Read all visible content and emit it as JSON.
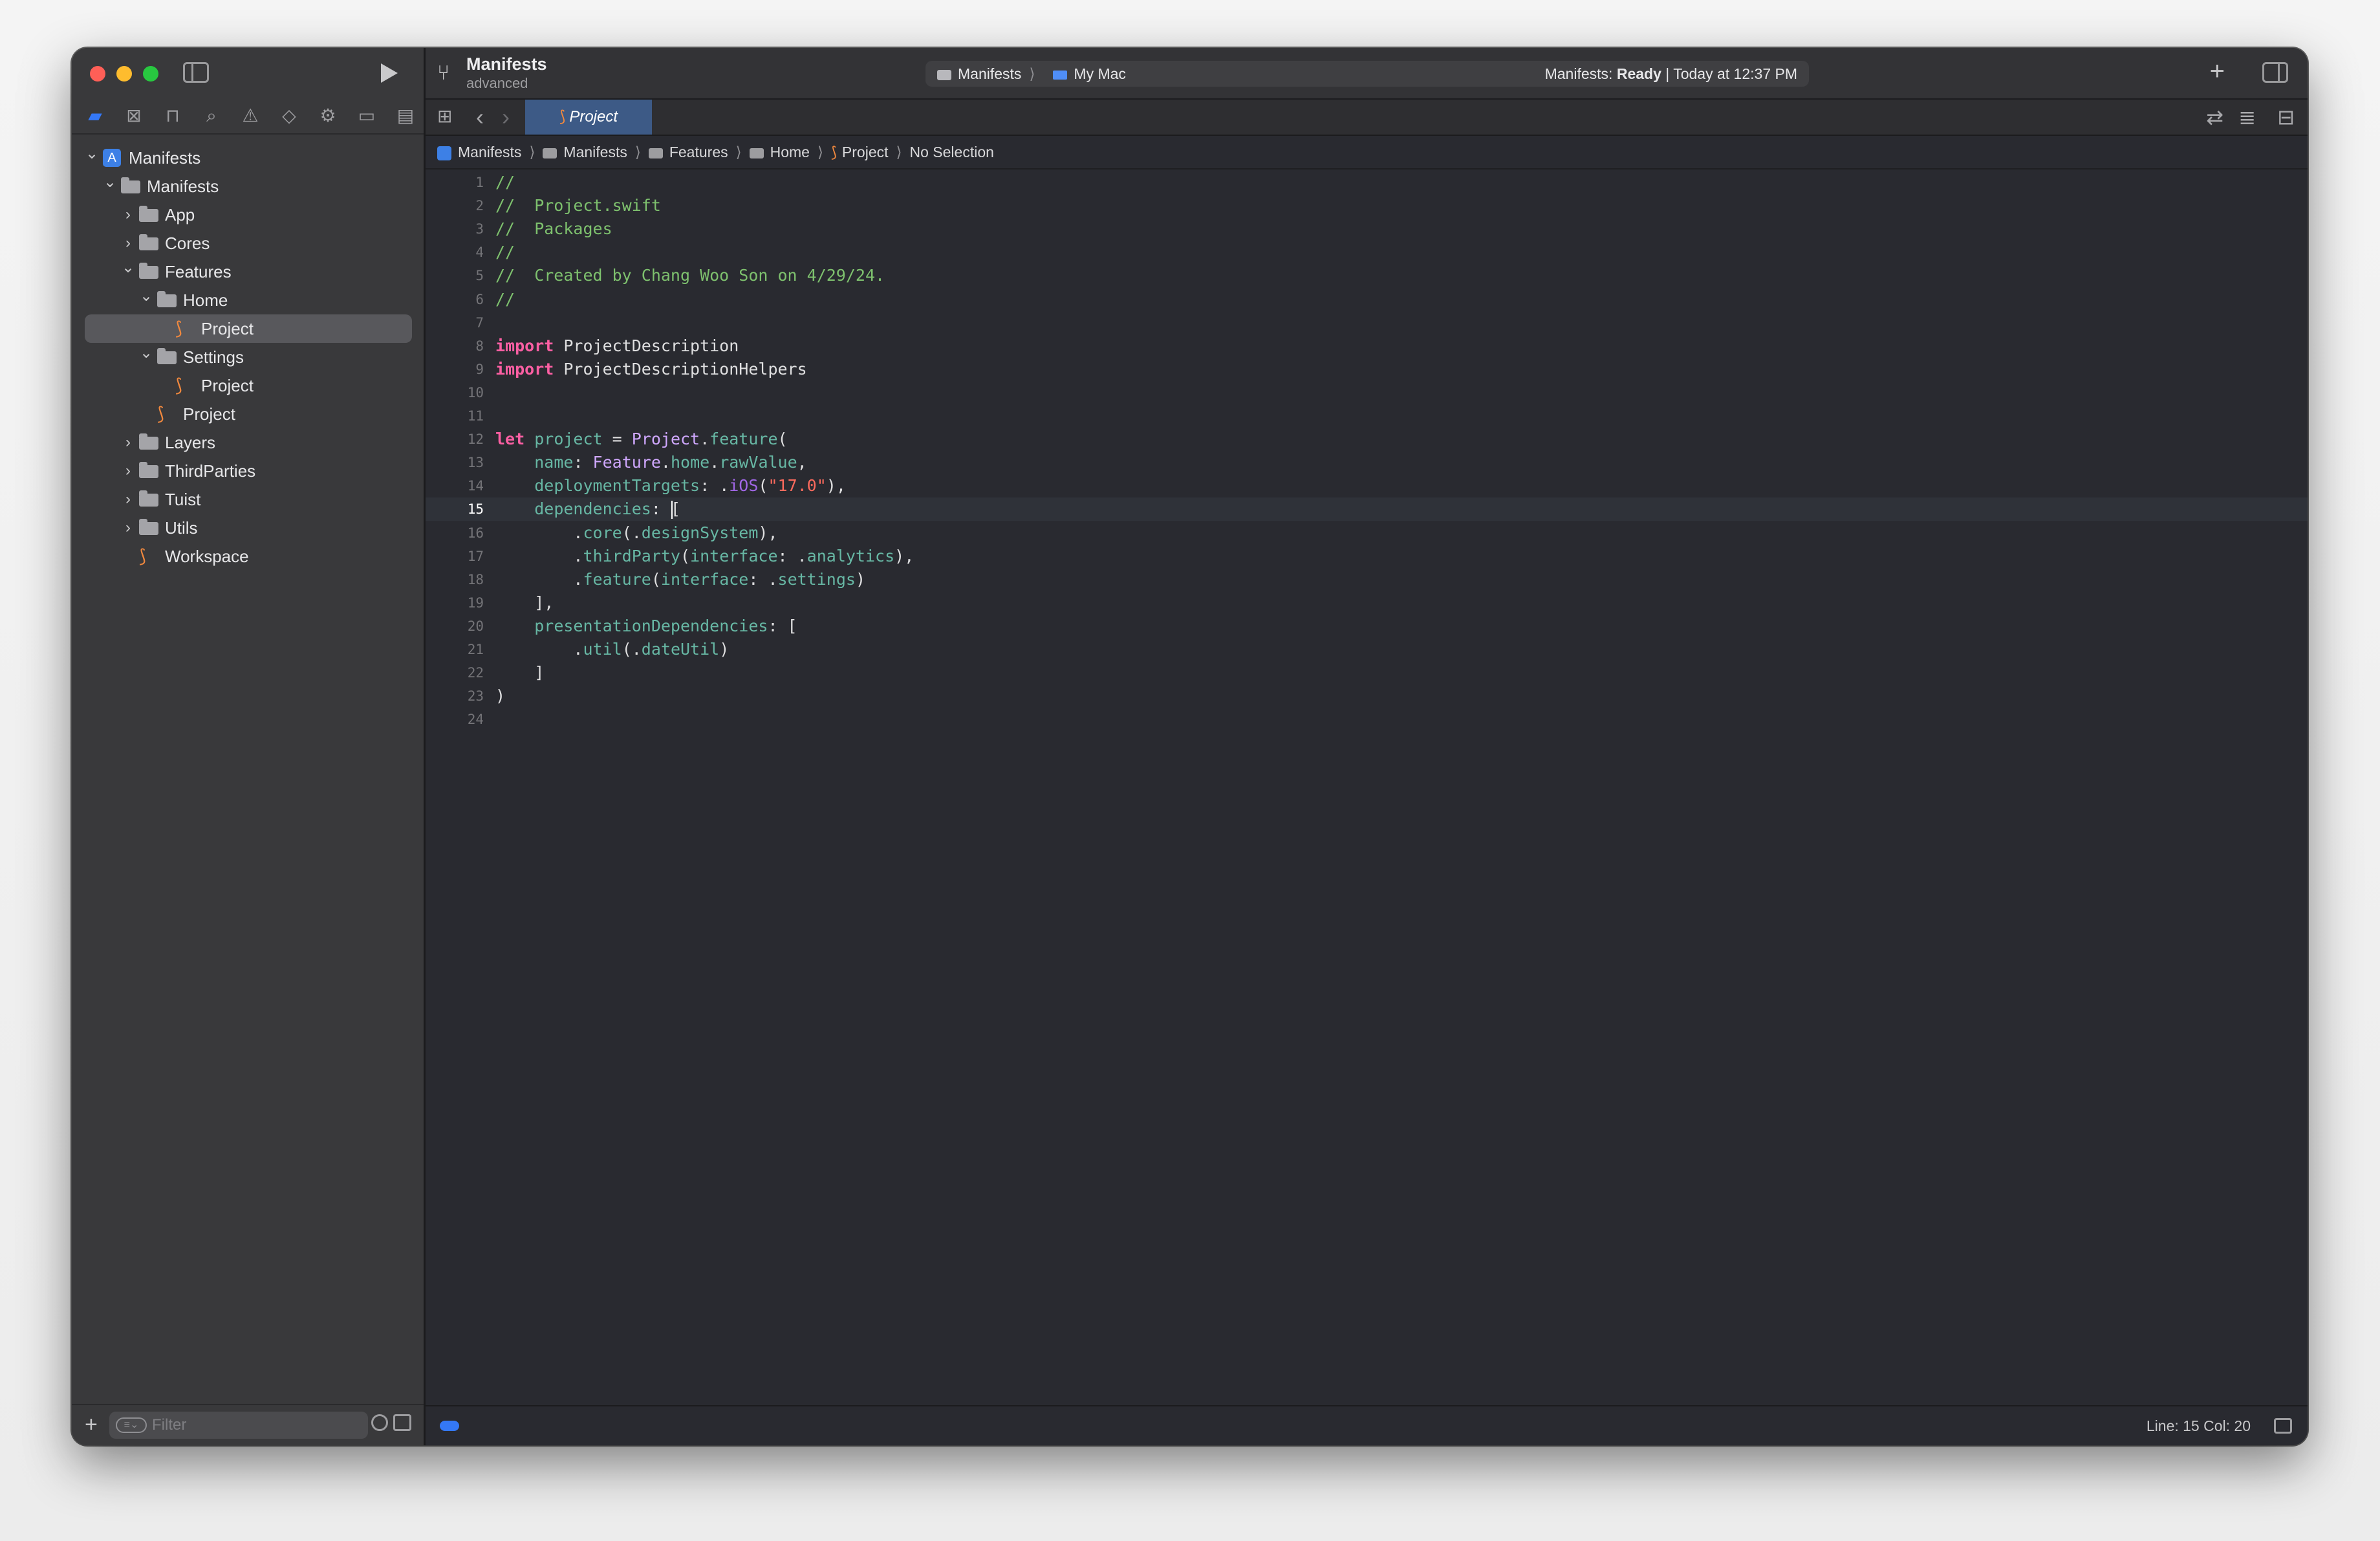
{
  "window": {
    "scheme": {
      "name": "Manifests",
      "branch": "advanced"
    },
    "activity": {
      "target": "Manifests",
      "destination": "My Mac",
      "status_prefix": "Manifests: ",
      "status_state": "Ready",
      "status_suffix": " | Today at 12:37 PM"
    }
  },
  "sidebar": {
    "tree": [
      {
        "label": "Manifests",
        "icon": "project-icon",
        "indent": 0,
        "expanded": true
      },
      {
        "label": "Manifests",
        "icon": "folder-icon",
        "indent": 1,
        "expanded": true
      },
      {
        "label": "App",
        "icon": "folder-icon",
        "indent": 2,
        "expanded": false
      },
      {
        "label": "Cores",
        "icon": "folder-icon",
        "indent": 2,
        "expanded": false
      },
      {
        "label": "Features",
        "icon": "folder-icon",
        "indent": 2,
        "expanded": true
      },
      {
        "label": "Home",
        "icon": "folder-icon",
        "indent": 3,
        "expanded": true
      },
      {
        "label": "Project",
        "icon": "swift-icon",
        "indent": 4,
        "selected": true
      },
      {
        "label": "Settings",
        "icon": "folder-icon",
        "indent": 3,
        "expanded": true
      },
      {
        "label": "Project",
        "icon": "swift-icon",
        "indent": 4
      },
      {
        "label": "Project",
        "icon": "swift-icon",
        "indent": 3
      },
      {
        "label": "Layers",
        "icon": "folder-icon",
        "indent": 2,
        "expanded": false
      },
      {
        "label": "ThirdParties",
        "icon": "folder-icon",
        "indent": 2,
        "expanded": false
      },
      {
        "label": "Tuist",
        "icon": "folder-icon",
        "indent": 2,
        "expanded": false
      },
      {
        "label": "Utils",
        "icon": "folder-icon",
        "indent": 2,
        "expanded": false
      },
      {
        "label": "Workspace",
        "icon": "swift-icon",
        "indent": 2
      }
    ],
    "filter_placeholder": "Filter"
  },
  "tab": {
    "label": "Project"
  },
  "jumpbar": [
    "Manifests",
    "Manifests",
    "Features",
    "Home",
    "Project",
    "No Selection"
  ],
  "editor": {
    "current_line": 15,
    "lines": [
      [
        [
          "c",
          "//"
        ]
      ],
      [
        [
          "c",
          "//  Project.swift"
        ]
      ],
      [
        [
          "c",
          "//  Packages"
        ]
      ],
      [
        [
          "c",
          "//"
        ]
      ],
      [
        [
          "c",
          "//  Created by Chang Woo Son on 4/29/24."
        ]
      ],
      [
        [
          "c",
          "//"
        ]
      ],
      [],
      [
        [
          "k",
          "import"
        ],
        [
          "p",
          " ProjectDescription"
        ]
      ],
      [
        [
          "k",
          "import"
        ],
        [
          "p",
          " ProjectDescriptionHelpers"
        ]
      ],
      [],
      [],
      [
        [
          "k",
          "let"
        ],
        [
          "p",
          " "
        ],
        [
          "d",
          "project"
        ],
        [
          "p",
          " = "
        ],
        [
          "t",
          "Project"
        ],
        [
          "p",
          "."
        ],
        [
          "f",
          "feature"
        ],
        [
          "p",
          "("
        ]
      ],
      [
        [
          "p",
          "    "
        ],
        [
          "d",
          "name"
        ],
        [
          "p",
          ": "
        ],
        [
          "t",
          "Feature"
        ],
        [
          "p",
          "."
        ],
        [
          "f",
          "home"
        ],
        [
          "p",
          "."
        ],
        [
          "f",
          "rawValue"
        ],
        [
          "p",
          ","
        ]
      ],
      [
        [
          "p",
          "    "
        ],
        [
          "d",
          "deploymentTargets"
        ],
        [
          "p",
          ": ."
        ],
        [
          "m",
          "iOS"
        ],
        [
          "p",
          "("
        ],
        [
          "s",
          "\"17.0\""
        ],
        [
          "p",
          "),"
        ]
      ],
      [
        [
          "p",
          "    "
        ],
        [
          "d",
          "dependencies"
        ],
        [
          "p",
          ": ["
        ]
      ],
      [
        [
          "p",
          "        ."
        ],
        [
          "f",
          "core"
        ],
        [
          "p",
          "(."
        ],
        [
          "f",
          "designSystem"
        ],
        [
          "p",
          "),"
        ]
      ],
      [
        [
          "p",
          "        ."
        ],
        [
          "f",
          "thirdParty"
        ],
        [
          "p",
          "("
        ],
        [
          "f",
          "interface"
        ],
        [
          "p",
          ": ."
        ],
        [
          "f",
          "analytics"
        ],
        [
          "p",
          "),"
        ]
      ],
      [
        [
          "p",
          "        ."
        ],
        [
          "f",
          "feature"
        ],
        [
          "p",
          "("
        ],
        [
          "f",
          "interface"
        ],
        [
          "p",
          ": ."
        ],
        [
          "f",
          "settings"
        ],
        [
          "p",
          ")"
        ]
      ],
      [
        [
          "p",
          "    ],"
        ]
      ],
      [
        [
          "p",
          "    "
        ],
        [
          "d",
          "presentationDependencies"
        ],
        [
          "p",
          ": ["
        ]
      ],
      [
        [
          "p",
          "        ."
        ],
        [
          "f",
          "util"
        ],
        [
          "p",
          "(."
        ],
        [
          "f",
          "dateUtil"
        ],
        [
          "p",
          ")"
        ]
      ],
      [
        [
          "p",
          "    ]"
        ]
      ],
      [
        [
          "p",
          ")"
        ]
      ],
      []
    ]
  },
  "status": {
    "position": "Line: 15  Col: 20"
  },
  "colors": {
    "comment": "#7ec16e",
    "keyword": "#fc5fa3",
    "decl": "#67b7a4",
    "type": "#d0a8ff",
    "func": "#67b7a4",
    "member": "#a167e6",
    "string": "#fc6a5d",
    "plain": "#dfdfe0",
    "accent": "#3478f6"
  }
}
